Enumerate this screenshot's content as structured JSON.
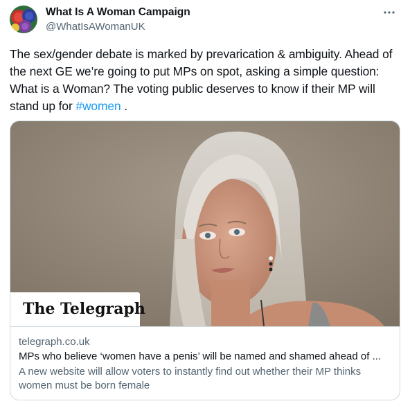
{
  "author": {
    "name": "What Is A Woman Campaign",
    "handle": "@WhatIsAWomanUK",
    "avatar_icon": "campaign-badges-avatar"
  },
  "more_icon": "more-horizontal-icon",
  "tweet": {
    "text_before": "The sex/gender debate is marked by prevarication & ambiguity. Ahead of the next GE we’re going to put MPs on spot, asking a simple question: What is a Woman? The voting public deserves to know if their MP will stand up for ",
    "hashtag": "#women",
    "text_after": " ."
  },
  "card": {
    "publisher_logo": "The Telegraph",
    "domain": "telegraph.co.uk",
    "title": "MPs who believe ‘women have a penis’ will be named and shamed ahead of ...",
    "description": "A new website will allow voters to instantly find out whether their MP thinks women must be born female"
  },
  "colors": {
    "link": "#1d9bf0",
    "secondary_text": "#536471",
    "border": "#cfd9de",
    "primary_text": "#0f1419"
  }
}
